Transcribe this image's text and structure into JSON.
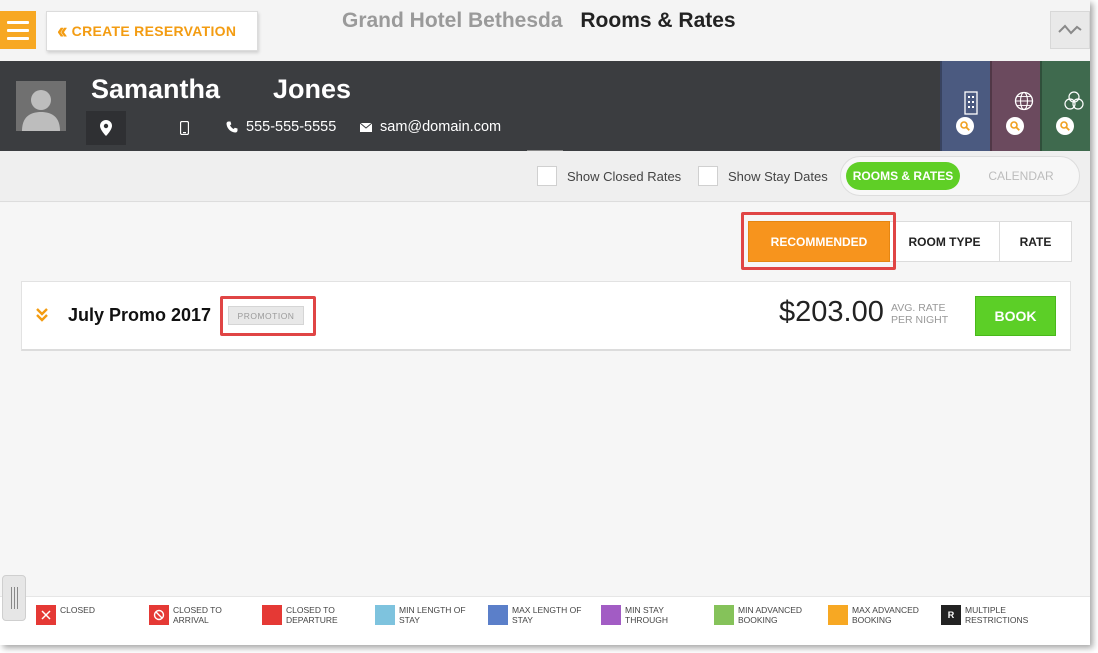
{
  "header": {
    "create_reservation_label": "CREATE RESERVATION",
    "hotel_name": "Grand Hotel Bethesda",
    "section_title": "Rooms & Rates"
  },
  "guest": {
    "first_name": "Samantha",
    "last_name": "Jones",
    "phone": "555-555-5555",
    "email": "sam@domain.com"
  },
  "side_tiles": [
    {
      "icon": "building-icon",
      "color": "#4b5a80"
    },
    {
      "icon": "globe-icon",
      "color": "#6b4a5e"
    },
    {
      "icon": "circles-icon",
      "color": "#3f6a4e"
    }
  ],
  "options": {
    "show_closed_rates": "Show Closed Rates",
    "show_stay_dates": "Show Stay Dates",
    "view_toggle": {
      "active": "ROOMS & RATES",
      "inactive": "CALENDAR"
    }
  },
  "sort": {
    "recommended": "RECOMMENDED",
    "room_type": "ROOM TYPE",
    "rate": "RATE"
  },
  "rates": [
    {
      "name": "July Promo 2017",
      "badge": "PROMOTION",
      "price": "$203.00",
      "avg_label": "AVG. RATE PER NIGHT",
      "book_label": "BOOK"
    }
  ],
  "legend": [
    {
      "label": "CLOSED",
      "color": "#e53935",
      "icon": "x-icon"
    },
    {
      "label": "CLOSED TO ARRIVAL",
      "color": "#e53935",
      "icon": "no-entry-icon"
    },
    {
      "label": "CLOSED TO DEPARTURE",
      "color": "#e53935",
      "icon": ""
    },
    {
      "label": "MIN LENGTH OF STAY",
      "color": "#7ec3de",
      "icon": ""
    },
    {
      "label": "MAX LENGTH OF STAY",
      "color": "#5b7fc9",
      "icon": ""
    },
    {
      "label": "MIN STAY THROUGH",
      "color": "#a25cc4",
      "icon": ""
    },
    {
      "label": "MIN ADVANCED BOOKING",
      "color": "#85c25a",
      "icon": ""
    },
    {
      "label": "MAX ADVANCED BOOKING",
      "color": "#f7a823",
      "icon": ""
    },
    {
      "label": "MULTIPLE RESTRICTIONS",
      "color": "#222222",
      "icon": "letter-r-icon",
      "glyph": "R"
    }
  ]
}
